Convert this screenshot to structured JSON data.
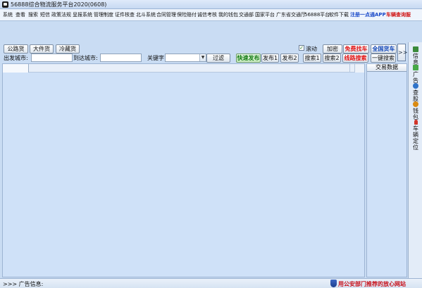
{
  "window": {
    "title": "56888综合物流服务平台2020(0608)"
  },
  "menu": {
    "items": [
      {
        "label": "系统"
      },
      {
        "label": "查看"
      },
      {
        "label": "搜索"
      },
      {
        "label": "短信"
      },
      {
        "label": "政策法规"
      },
      {
        "label": "呈报系统"
      },
      {
        "label": "管理制度"
      },
      {
        "label": "证件核查"
      },
      {
        "label": "北斗系统"
      },
      {
        "label": "合同管理"
      },
      {
        "label": "保险赔付"
      },
      {
        "label": "诚信考核"
      },
      {
        "label": "我的钱包"
      },
      {
        "label": "交通部"
      },
      {
        "label": "国家平台"
      },
      {
        "label": "广东省交通厅"
      },
      {
        "label": "56888平台"
      },
      {
        "label": "软件下载"
      }
    ],
    "register_app": "注册一点通APP",
    "vehicle_query": "车辆查询服"
  },
  "toolbar": {
    "tab_public": "公路货",
    "tab_bulk": "大件货",
    "tab_cold": "冷藏货",
    "scroll_label": "滚动",
    "scroll_checked": true,
    "encrypt": "加密",
    "free_find": "免费找车",
    "national": "全国货车",
    "depart_label": "出发城市:",
    "arrive_label": "到达城市:",
    "keyword_label": "关键字",
    "filter": "过滤",
    "quick_publish": "快速发布",
    "publish1": "发布1",
    "publish2": "发布2",
    "search1": "搜索1",
    "search2": "搜索2",
    "route_search": "线路搜索",
    "one_key_search": "一键搜索",
    "collapse": ">>"
  },
  "side_panel": {
    "header": "交易数据"
  },
  "right_toolbar": [
    {
      "label": "信息",
      "icon": "info-icon",
      "color": "#3a8a3a"
    },
    {
      "label": "广告",
      "icon": "ad-icon",
      "color": "#47a847"
    },
    {
      "label": "查股",
      "icon": "stock-icon",
      "color": "#2f73c9"
    },
    {
      "label": "钱包",
      "icon": "wallet-icon",
      "color": "#d98a12"
    },
    {
      "label": "车辆定位",
      "icon": "location-icon",
      "color": "#d0352a"
    }
  ],
  "status": {
    "ad_label": ">>> 广告信息:",
    "police_link": "用公安部门推荐的放心网站"
  }
}
